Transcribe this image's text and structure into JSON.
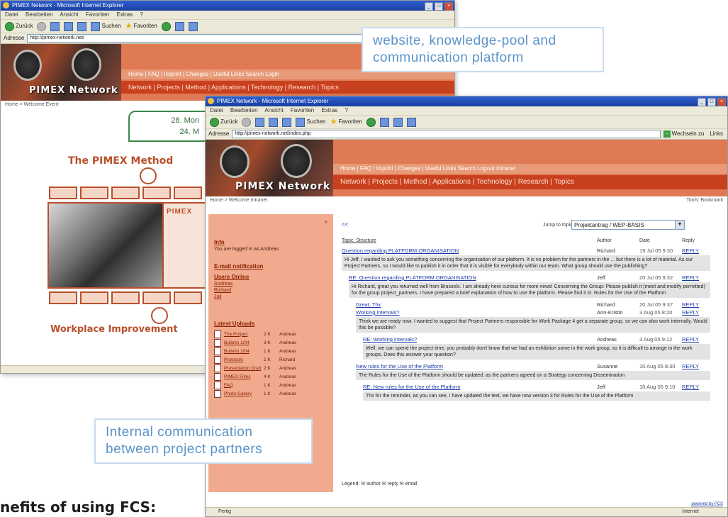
{
  "back_window": {
    "title": "PIMEX Network - Microsoft Internet Explorer",
    "menu": [
      "Datei",
      "Bearbeiten",
      "Ansicht",
      "Favoriten",
      "Extras",
      "?"
    ],
    "toolbar": {
      "back": "Zurück",
      "search": "Suchen",
      "favorites": "Favoriten"
    },
    "address_label": "Adresse",
    "address_value": "http://pimex-network.net/",
    "logo": "PIMEX Network",
    "nav_top": "Home | FAQ | Imprint | Changes | Useful Links       Search       Login",
    "nav_main": "Network | Projects | Method | Applications | Technology | Research | Topics",
    "breadcrumb": "Home > Welcome Event",
    "date_line1": "28. Mon",
    "date_line2": "24. M",
    "method_title": "The PIMEX Method",
    "pimex_label": "PIMEX",
    "footer_title": "Workplace Improvement"
  },
  "front_window": {
    "title": "PIMEX Network - Microsoft Internet Explorer",
    "menu": [
      "Datei",
      "Bearbeiten",
      "Ansicht",
      "Favoriten",
      "Extras",
      "?"
    ],
    "toolbar": {
      "back": "Zurück",
      "search": "Suchen",
      "favorites": "Favoriten"
    },
    "address_label": "Adresse",
    "address_value": "http://pimex-network.net/index.php",
    "go_label": "Wechseln zu",
    "links_label": "Links",
    "logo": "PIMEX Network",
    "nav_top": "Home | FAQ | Imprint | Changes | Useful Links       Search       Logout Intranet",
    "nav_main": "Network | Projects | Method | Applications | Technology | Research | Topics",
    "breadcrumb": "Home > Welcome Intranet",
    "tools_label": "Tools: Bookmark",
    "sidebar": {
      "info_heading": "Info",
      "info_text": "You are logged in as Andreas",
      "email_heading": "E-mail notification",
      "users_heading": "Users Online",
      "users": [
        "Andreas",
        "Richard",
        "Juli"
      ],
      "latest_heading": "Latest Uploads",
      "files": [
        {
          "name": "The Project",
          "size": "2 K",
          "user": "Andreas"
        },
        {
          "name": "Bulletin 1/04",
          "size": "3 K",
          "user": "Andreas"
        },
        {
          "name": "Bulletin 2/04",
          "size": "1 K",
          "user": "Andreas"
        },
        {
          "name": "Protocols",
          "size": "1 K",
          "user": "Richard"
        },
        {
          "name": "Presentation Draft",
          "size": "2 K",
          "user": "Andreas"
        },
        {
          "name": "PIMEX Films",
          "size": "4 K",
          "user": "Andreas"
        },
        {
          "name": "FAQ",
          "size": "1 K",
          "user": "Andreas"
        },
        {
          "name": "Photo Gallery",
          "size": "1 K",
          "user": "Andreas"
        }
      ]
    },
    "forum": {
      "back_link": "<<",
      "jump_label": "Jump to topic",
      "jump_value": "Projektantrag / WEP-BASIS",
      "columns": [
        "Topic, Structure",
        "Author",
        "Date",
        "Reply"
      ],
      "posts": [
        {
          "title": "Question regarding PLATFORM ORGANISATION",
          "author": "Richard",
          "date": "19 Jul 05 9:30",
          "reply": "REPLY",
          "body": "Hi Jeff, I wanted to ask you something concerning the organisation of our platform. It is no problem for the partners in the ... but there is a lot of material. As our Project Partners, so I would like to publish it in order that it is visible for everybody within our team. What group should use the publishing?"
        },
        {
          "title": "RE: Question regarding PLATFORM ORGANISATION",
          "author": "Jeff",
          "date": "20 Jul 05 9:32",
          "reply": "REPLY",
          "body": "Hi Richard, great you returned well from Brussels. I am already here curious for more news! Concerning the Group: Please publish it (meet and modify permitted) for the group project_partners. I have prepared a brief explanation of how to use the platform. Please find it in: Rules for the Use of the Platform"
        },
        {
          "title": "Great, Thx",
          "author": "Richard",
          "date": "20 Jul 05 9:37",
          "reply": "REPLY",
          "body": ""
        },
        {
          "title": "Working intervals?",
          "author": "Ann-Kristin",
          "date": "3 Aug 05 8:20",
          "reply": "REPLY",
          "body": "Think we are ready now. I wanted to suggest that Project Partners responsible for Work Package 4 get a separate group, so we can also work internally. Would this be possible?"
        },
        {
          "title": "RE: Working intervals?",
          "author": "Andreas",
          "date": "3 Aug 05 9:12",
          "reply": "REPLY",
          "body": "Well, we can spend the project time, you probably don't know that we had an exhibition some in the work group, so it is difficult to arrange in the work groups. Does this answer your question?"
        },
        {
          "title": "New rules for the Use of the Platform",
          "author": "Susanne",
          "date": "10 Aug 05 8:30",
          "reply": "REPLY",
          "body": "The Rules for the Use of the Platform should be updated, as the partners agreed on a Strategy concerning Dissemination"
        },
        {
          "title": "RE: New rules for the Use of the Platform",
          "author": "Jeff",
          "date": "10 Aug 05 9:10",
          "reply": "REPLY",
          "body": "Thx for the reminder, as you can see, I have updated the text, we have now version 3 for Rules for the Use of the Platform"
        }
      ],
      "legend": "Legend:  ✉ author   ✉ reply   ✉ email"
    },
    "status_left": "Fertig",
    "status_right": "Internet",
    "status_corner": "powered by FCS"
  },
  "callout_top": {
    "line1": "website, knowledge-pool and",
    "line2": "communication platform"
  },
  "callout_bottom": {
    "line1": "Internal communication",
    "line2": "between project partners"
  },
  "footer_heading": "nefits of using FCS:",
  "colors": {
    "accent_orange": "#c9401e",
    "light_orange": "#f1aa8e",
    "callout_blue": "#5a93c8",
    "link_blue": "#1a3aa8"
  }
}
